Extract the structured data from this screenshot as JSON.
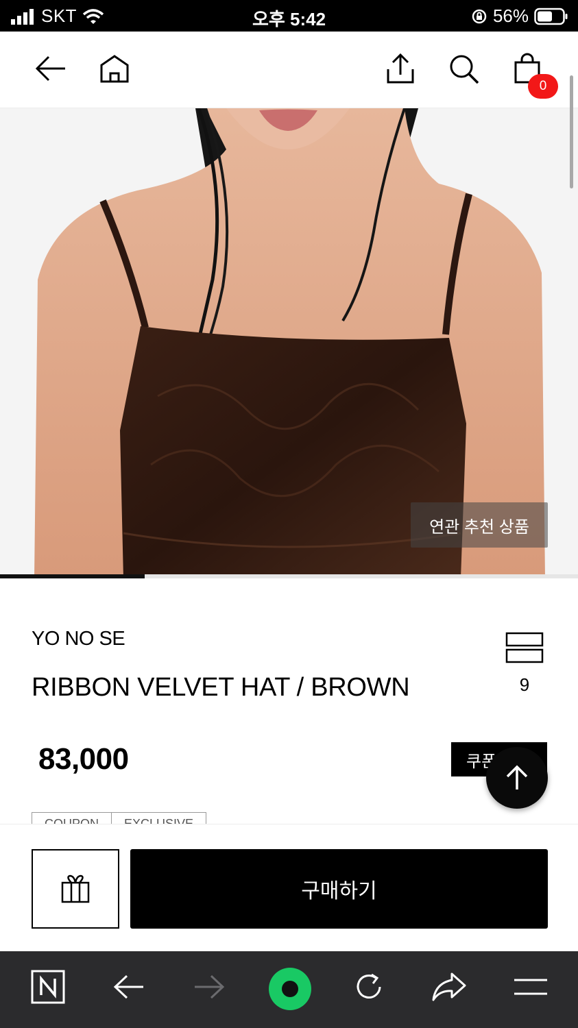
{
  "status_bar": {
    "carrier": "SKT",
    "time": "오후 5:42",
    "battery": "56%"
  },
  "top_nav": {
    "icons": [
      "back-arrow-icon",
      "home-icon",
      "share-icon",
      "search-icon",
      "cart-icon"
    ],
    "cart_count": "0"
  },
  "hero": {
    "related_label": "연관 추천 상품",
    "gallery_progress": 0.25
  },
  "product": {
    "brand": "YO NO SE",
    "name": "RIBBON VELVET HAT / BROWN",
    "like_count": "9",
    "price": "83,000",
    "coupon_label": "쿠폰",
    "tags": [
      "COUPON",
      "EXCLUSIVE"
    ]
  },
  "purchase": {
    "buy_label": "구매하기"
  },
  "browser_toolbar": {
    "icons": [
      "naver-n-icon",
      "back-icon",
      "forward-icon",
      "green-home-icon",
      "reload-icon",
      "share-icon",
      "menu-icon"
    ]
  },
  "colors": {
    "accent": "#000000",
    "badge": "#f21818",
    "browser_bar": "#2b2b2d",
    "green": "#19c964"
  }
}
